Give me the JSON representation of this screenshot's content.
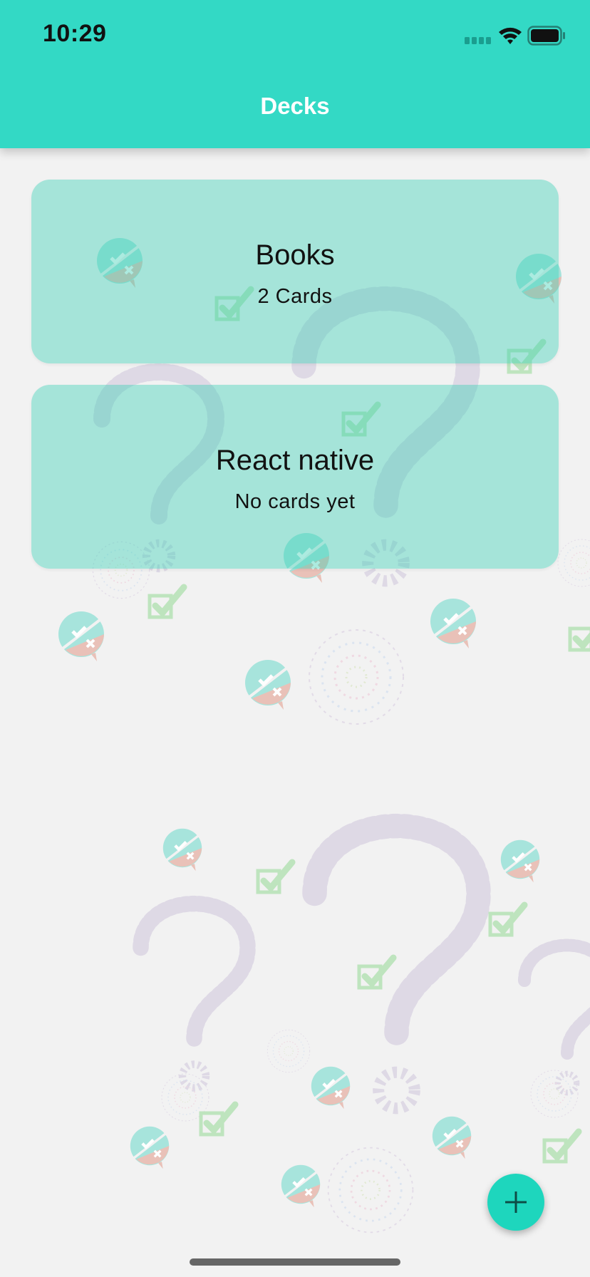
{
  "status_bar": {
    "time": "10:29",
    "icons": [
      "signal-icon",
      "wifi-icon",
      "battery-icon"
    ]
  },
  "header": {
    "title": "Decks"
  },
  "decks": [
    {
      "title": "Books",
      "count_label": "2 Cards"
    },
    {
      "title": "React native",
      "count_label": "No cards yet"
    }
  ],
  "fab": {
    "icon": "plus-icon"
  },
  "colors": {
    "header": "#33d9c5",
    "card": "#a3ded5",
    "fab": "#1ed6bd",
    "background": "#f2f2f2"
  }
}
